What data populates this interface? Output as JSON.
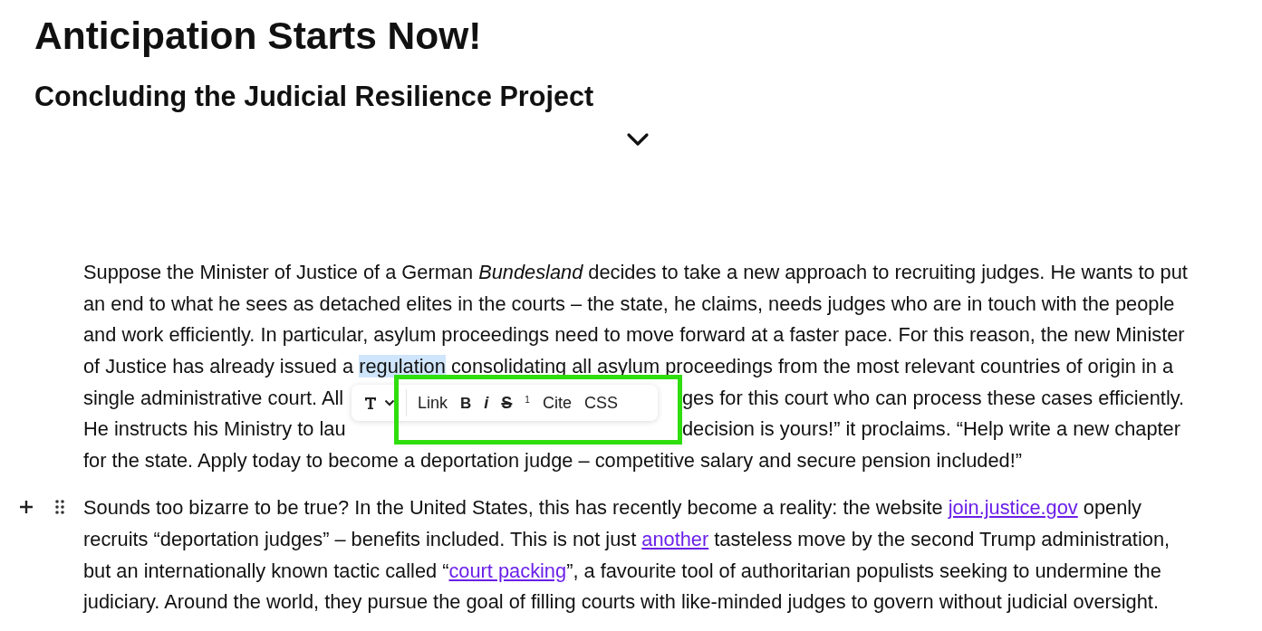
{
  "title": "Anticipation Starts Now!",
  "subtitle": "Concluding the Judicial Resilience Project",
  "paragraphs": [
    {
      "lines": [
        {
          "parts": [
            {
              "kind": "text",
              "text": "Suppose the Minister of Justice of a German *Bundesland* decides to take a new approach to recruiting judges. He wants to put"
            }
          ]
        },
        {
          "parts": [
            {
              "kind": "text",
              "text": "an end to what he sees as detached elites in the courts – the state, he claims, needs judges who are in touch with the people"
            }
          ]
        },
        {
          "parts": [
            {
              "kind": "text",
              "text": "and work efficiently. In particular, asylum proceedings need to move forward at a faster pace. For this reason, the new Minister"
            }
          ]
        },
        {
          "parts": [
            {
              "kind": "text",
              "text": "of Justice has already issued a "
            },
            {
              "kind": "selection",
              "text": "regulation"
            },
            {
              "kind": "text",
              "text": " consolidating all asylum proceedings from the most relevant countries of origin in a"
            }
          ]
        },
        {
          "parts": [
            {
              "kind": "text",
              "text": "single administrative court. All"
            },
            {
              "kind": "after-gap",
              "text": "ges for this court who can process these cases efficiently."
            }
          ]
        },
        {
          "parts": [
            {
              "kind": "text",
              "text": "He instructs his Ministry to lau"
            },
            {
              "kind": "after-gap",
              "text": "decision is yours!” it proclaims. “Help write a new chapter"
            }
          ]
        },
        {
          "parts": [
            {
              "kind": "text",
              "text": "for the state. Apply today to become a deportation judge – competitive salary and secure pension included!”"
            }
          ]
        }
      ],
      "toolbar": {
        "items": [
          {
            "kind": "plain",
            "label": "Link"
          },
          {
            "kind": "bold",
            "label": "B"
          },
          {
            "kind": "italic",
            "label": "i"
          },
          {
            "kind": "strike",
            "label": "S"
          },
          {
            "kind": "super",
            "label": "1"
          },
          {
            "kind": "plain",
            "label": "Cite"
          },
          {
            "kind": "plain",
            "label": "CSS"
          }
        ]
      }
    },
    {
      "handles": true,
      "lines": [
        {
          "parts": [
            {
              "kind": "text",
              "text": "Sounds too bizarre to be true? In the United States, this has recently become a reality: the website "
            },
            {
              "kind": "link",
              "text": "join.justice.gov"
            },
            {
              "kind": "text",
              "text": " openly"
            }
          ]
        },
        {
          "parts": [
            {
              "kind": "text",
              "text": "recruits “deportation judges” – benefits included. This is not just "
            },
            {
              "kind": "link",
              "text": "another"
            },
            {
              "kind": "text",
              "text": " tasteless move by the second Trump administration,"
            }
          ]
        },
        {
          "parts": [
            {
              "kind": "text",
              "text": "but an internationally known tactic called “"
            },
            {
              "kind": "link",
              "text": "court packing"
            },
            {
              "kind": "text",
              "text": "”, a favourite tool of authoritarian populists seeking to undermine the"
            }
          ]
        },
        {
          "parts": [
            {
              "kind": "text",
              "text": "judiciary. Around the world, they pursue the goal of filling courts with like-minded judges to govern without judicial oversight."
            }
          ]
        }
      ]
    }
  ]
}
